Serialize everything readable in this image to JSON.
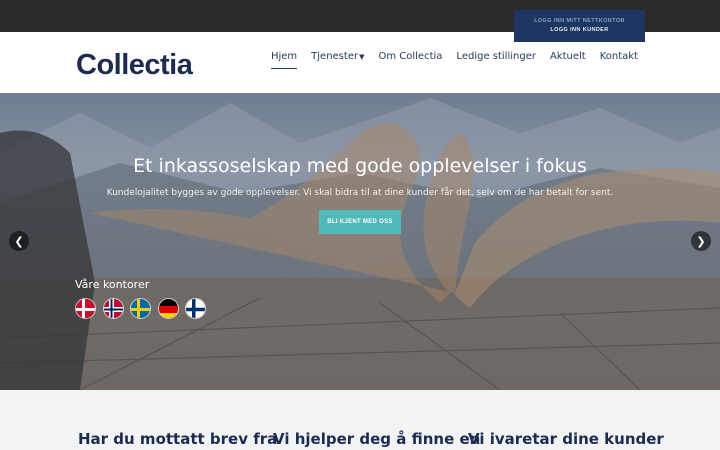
{
  "login": {
    "primary": "LOGG INN MITT NETTKONTOR",
    "secondary": "LOGG INN KUNDER"
  },
  "header": {
    "logo": "Collectia",
    "nav": [
      {
        "label": "Hjem",
        "active": true
      },
      {
        "label": "Tjenester",
        "has_dropdown": true
      },
      {
        "label": "Om Collectia"
      },
      {
        "label": "Ledige stillinger"
      },
      {
        "label": "Aktuelt"
      },
      {
        "label": "Kontakt"
      }
    ]
  },
  "hero": {
    "title": "Et inkassoselskap med gode opplevelser i fokus",
    "subtitle": "Kundelojalitet bygges av gode opplevelser. Vi skal bidra til at dine kunder får det, selv om de har betalt for sent.",
    "cta": "BLI KJENT MED OSS",
    "offices_label": "Våre kontorer",
    "flags": [
      "denmark-flag",
      "norway-flag",
      "sweden-flag",
      "germany-flag",
      "finland-flag"
    ],
    "prev_icon": "chevron-left-icon",
    "next_icon": "chevron-right-icon"
  },
  "columns": [
    {
      "title": "Har du mottatt brev fra"
    },
    {
      "title": "Vi hjelper deg å finne en"
    },
    {
      "title": "Vi ivaretar dine kunder"
    }
  ],
  "colors": {
    "topbar": "#2a2a2a",
    "login_bg": "#1d3661",
    "brand_navy": "#1c2b4f",
    "cta": "#52b9ba"
  }
}
